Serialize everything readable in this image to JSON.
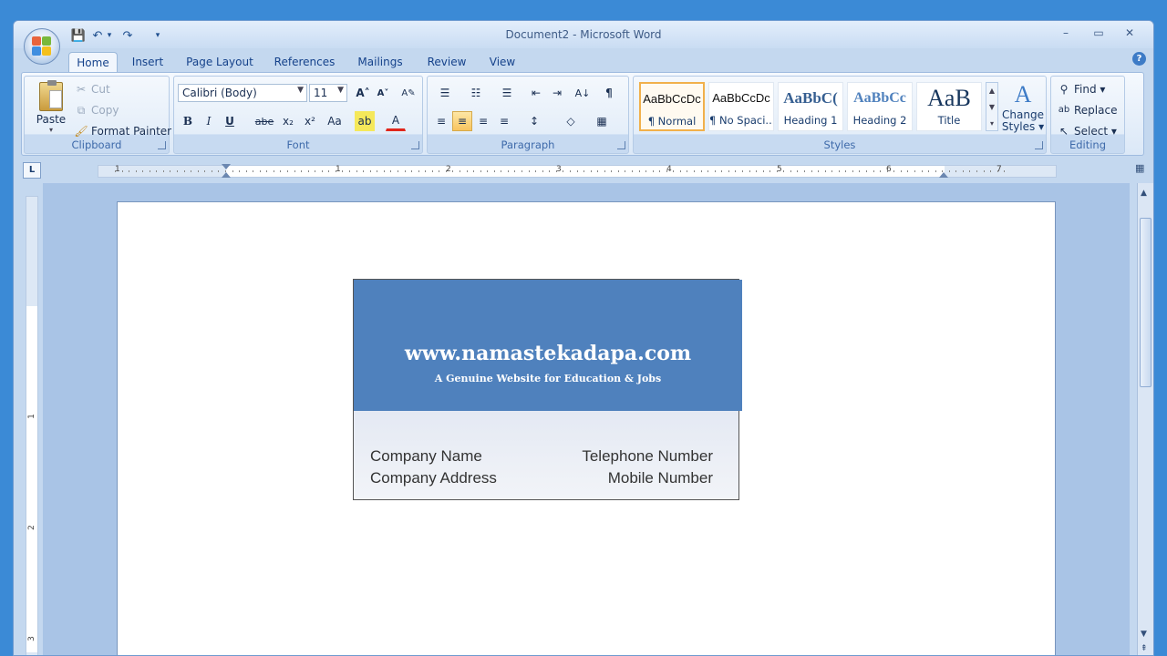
{
  "window": {
    "title": "Document2 - Microsoft Word",
    "controls": {
      "minimize": "–",
      "maximize": "▭",
      "close": "✕"
    }
  },
  "quick_access": {
    "save": "💾",
    "undo": "↶",
    "undo_arrow": "▾",
    "redo": "↷",
    "customize": "▾"
  },
  "tabs": [
    "Home",
    "Insert",
    "Page Layout",
    "References",
    "Mailings",
    "Review",
    "View"
  ],
  "active_tab": "Home",
  "help": "?",
  "ribbon": {
    "clipboard": {
      "label": "Clipboard",
      "paste": "Paste",
      "paste_arrow": "▾",
      "cut": "Cut",
      "copy": "Copy",
      "format_painter": "Format Painter"
    },
    "font": {
      "label": "Font",
      "font_name": "Calibri (Body)",
      "font_size": "11",
      "grow": "A˄",
      "shrink": "A˅",
      "clear": "A✎",
      "bold": "B",
      "italic": "I",
      "underline": "U",
      "strike": "abe",
      "subscript": "x₂",
      "superscript": "x²",
      "change_case": "Aa",
      "highlight": "ab",
      "font_color": "A"
    },
    "paragraph": {
      "label": "Paragraph",
      "bullets": "☰",
      "numbering": "☷",
      "multilevel": "☰",
      "decrease_indent": "⇤",
      "increase_indent": "⇥",
      "sort": "A↓",
      "show_marks": "¶",
      "align_left": "≡",
      "align_center": "≡",
      "align_right": "≡",
      "justify": "≡",
      "line_spacing": "↕",
      "shading": "◇",
      "borders": "▦"
    },
    "styles": {
      "label": "Styles",
      "items": [
        {
          "sample": "AaBbCcDc",
          "name": "¶ Normal"
        },
        {
          "sample": "AaBbCcDc",
          "name": "¶ No Spaci..."
        },
        {
          "sample": "AaBbC(",
          "name": "Heading 1"
        },
        {
          "sample": "AaBbCc",
          "name": "Heading 2"
        },
        {
          "sample": "AaB",
          "name": "Title"
        }
      ],
      "change_styles": "Change",
      "change_styles_2": "Styles ▾"
    },
    "editing": {
      "label": "Editing",
      "find": "Find ▾",
      "replace": "Replace",
      "select": "Select ▾"
    }
  },
  "ruler": {
    "tab_selector": "L",
    "h_numbers": [
      "1",
      "1",
      "2",
      "3",
      "4",
      "5",
      "6",
      "7"
    ],
    "v_numbers": [
      "1",
      "2",
      "3"
    ]
  },
  "card": {
    "website": "www.namastekadapa.com",
    "tagline": "A Genuine Website for Education & Jobs",
    "company_name": "Company Name",
    "company_address": "Company Address",
    "telephone": "Telephone Number",
    "mobile": "Mobile Number"
  },
  "colors": {
    "banner": "#4f81bd",
    "selected_style_border": "#f1b04b",
    "title_text": "#3e5b86"
  }
}
